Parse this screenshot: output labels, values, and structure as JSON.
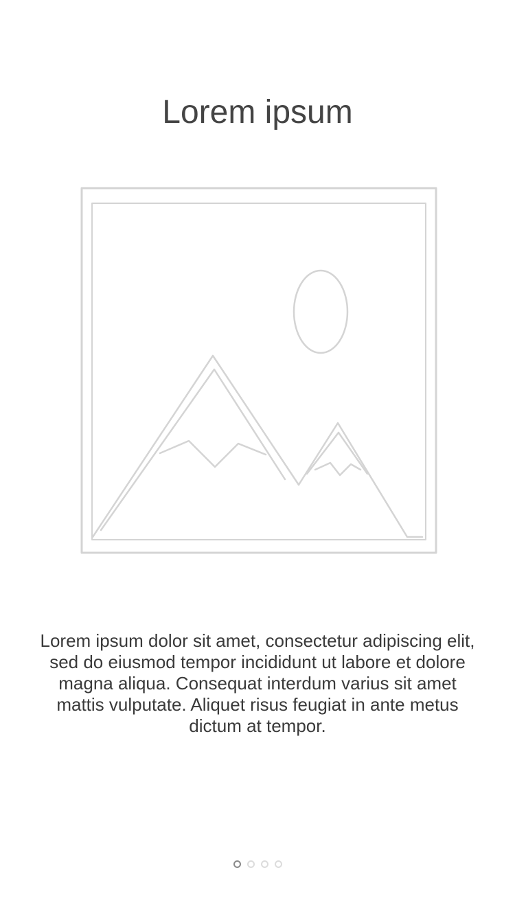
{
  "onboarding": {
    "title": "Lorem ipsum",
    "description": "Lorem ipsum dolor sit amet, consectetur adipiscing elit, sed do eiusmod tempor incididunt ut labore et dolore magna aliqua. Consequat interdum varius sit amet mattis vulputate. Aliquet risus feugiat in ante metus dictum at tempor.",
    "illustration_icon": "image-placeholder-icon",
    "pager": {
      "total_pages": 4,
      "current_page": 1
    },
    "colors": {
      "background": "#ffffff",
      "title": "#444444",
      "text": "#3a3a3a",
      "illustration_stroke": "#d4d4d4",
      "dot_active": "#8a8a8a",
      "dot_inactive": "#dcdcdc"
    }
  }
}
